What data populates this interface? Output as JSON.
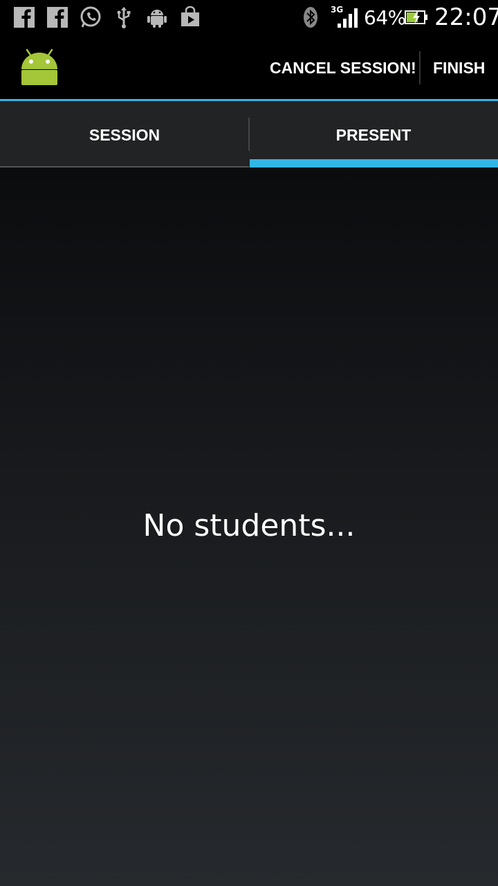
{
  "status_bar": {
    "left_icons": [
      "facebook-icon",
      "facebook-icon",
      "whatsapp-icon",
      "usb-icon",
      "android-debug-icon",
      "play-store-icon"
    ],
    "network_type": "3G",
    "battery_percent": "64%",
    "time": "22:07"
  },
  "action_bar": {
    "app_icon": "android-icon",
    "actions": {
      "cancel_session": "CANCEL SESSION!",
      "finish": "FINISH"
    },
    "accent_color": "#33b5e5"
  },
  "tabs": [
    {
      "label": "SESSION",
      "selected": false
    },
    {
      "label": "PRESENT",
      "selected": true
    }
  ],
  "content": {
    "empty_message": "No students..."
  }
}
